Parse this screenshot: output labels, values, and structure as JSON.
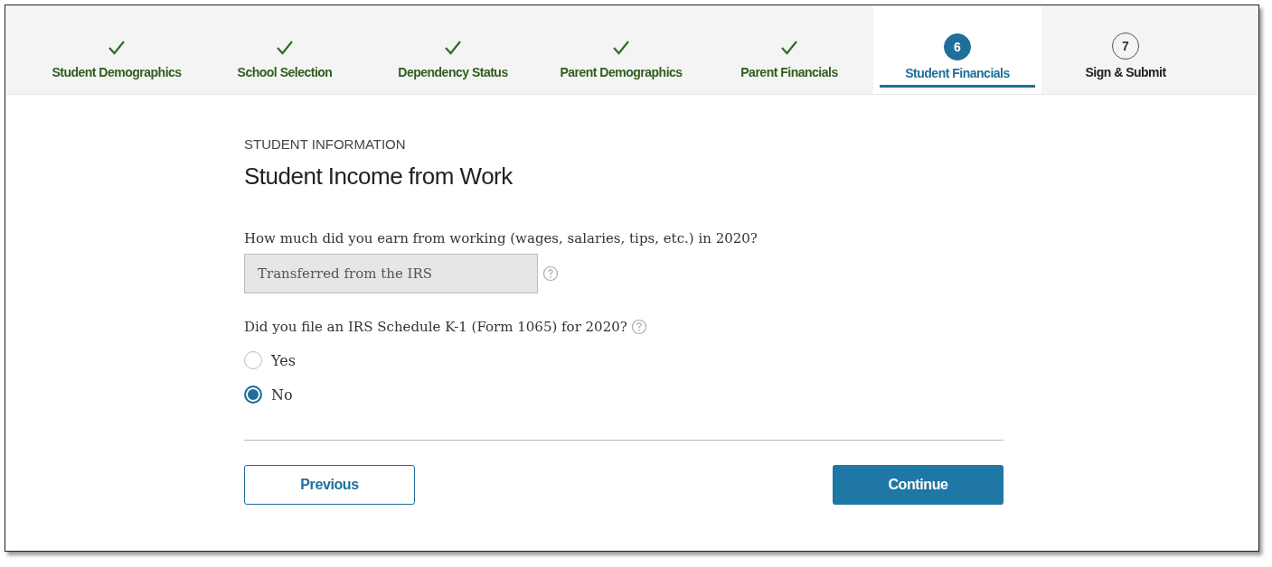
{
  "steps": [
    {
      "label": "Student Demographics",
      "completed": true,
      "selected": false
    },
    {
      "label": "School Selection",
      "completed": true,
      "selected": false
    },
    {
      "label": "Dependency Status",
      "completed": true,
      "selected": false
    },
    {
      "label": "Parent Demographics",
      "completed": true,
      "selected": false
    },
    {
      "label": "Parent Financials",
      "completed": true,
      "selected": false
    },
    {
      "number": "6",
      "label": "Student Financials",
      "completed": false,
      "selected": true
    },
    {
      "number": "7",
      "label": "Sign & Submit",
      "completed": false,
      "selected": false
    }
  ],
  "section_label": "STUDENT INFORMATION",
  "heading": "Student Income from Work",
  "income_question": {
    "label": "How much did you earn from working (wages, salaries, tips, etc.) in 2020?",
    "value": "Transferred from the IRS",
    "disabled": true
  },
  "k1_question": {
    "label": "Did you file an IRS Schedule K-1 (Form 1065) for 2020?",
    "options": [
      {
        "label": "Yes",
        "selected": false
      },
      {
        "label": "No",
        "selected": true
      }
    ]
  },
  "buttons": {
    "previous": "Previous",
    "continue": "Continue"
  }
}
